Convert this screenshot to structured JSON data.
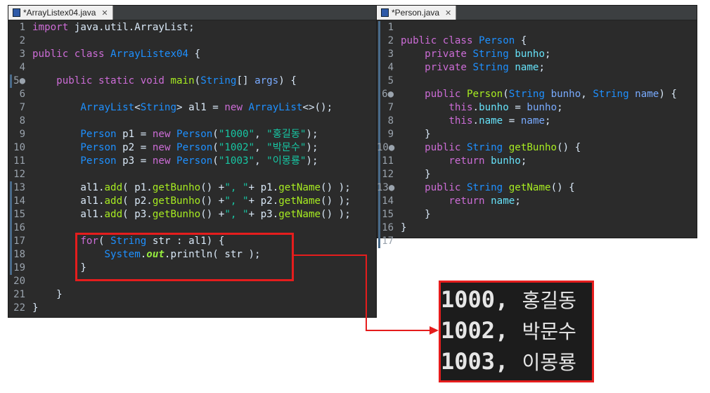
{
  "left_editor": {
    "tab_title": "*ArrayListex04.java",
    "close_glyph": "✕",
    "lines": [
      {
        "n": "1",
        "segs": [
          [
            "kw",
            "import "
          ],
          [
            "plain",
            "java.util.ArrayList;"
          ]
        ]
      },
      {
        "n": "2",
        "segs": []
      },
      {
        "n": "3",
        "segs": [
          [
            "kw",
            "public class "
          ],
          [
            "ty",
            "ArrayListex04 "
          ],
          [
            "plain",
            "{"
          ]
        ]
      },
      {
        "n": "4",
        "segs": []
      },
      {
        "n": "5●",
        "segs": [
          [
            "plain",
            "    "
          ],
          [
            "kw",
            "public static void "
          ],
          [
            "meth",
            "main"
          ],
          [
            "plain",
            "("
          ],
          [
            "ty",
            "String"
          ],
          [
            "plain",
            "[] "
          ],
          [
            "var",
            "args"
          ],
          [
            "plain",
            ") {"
          ]
        ]
      },
      {
        "n": "6",
        "segs": []
      },
      {
        "n": "7",
        "segs": [
          [
            "plain",
            "        "
          ],
          [
            "ty",
            "ArrayList"
          ],
          [
            "plain",
            "<"
          ],
          [
            "ty",
            "String"
          ],
          [
            "plain",
            "> "
          ],
          [
            "plain",
            "al1 = "
          ],
          [
            "kw",
            "new "
          ],
          [
            "ty",
            "ArrayList"
          ],
          [
            "plain",
            "<>();"
          ]
        ]
      },
      {
        "n": "8",
        "segs": []
      },
      {
        "n": "9",
        "segs": [
          [
            "plain",
            "        "
          ],
          [
            "ty",
            "Person "
          ],
          [
            "plain",
            "p1 = "
          ],
          [
            "kw",
            "new "
          ],
          [
            "ty",
            "Person"
          ],
          [
            "plain",
            "("
          ],
          [
            "str",
            "\"1000\""
          ],
          [
            "plain",
            ", "
          ],
          [
            "str",
            "\"홍길동\""
          ],
          [
            "plain",
            ");"
          ]
        ]
      },
      {
        "n": "10",
        "segs": [
          [
            "plain",
            "        "
          ],
          [
            "ty",
            "Person "
          ],
          [
            "plain",
            "p2 = "
          ],
          [
            "kw",
            "new "
          ],
          [
            "ty",
            "Person"
          ],
          [
            "plain",
            "("
          ],
          [
            "str",
            "\"1002\""
          ],
          [
            "plain",
            ", "
          ],
          [
            "str",
            "\"박문수\""
          ],
          [
            "plain",
            ");"
          ]
        ]
      },
      {
        "n": "11",
        "segs": [
          [
            "plain",
            "        "
          ],
          [
            "ty",
            "Person "
          ],
          [
            "plain",
            "p3 = "
          ],
          [
            "kw",
            "new "
          ],
          [
            "ty",
            "Person"
          ],
          [
            "plain",
            "("
          ],
          [
            "str",
            "\"1003\""
          ],
          [
            "plain",
            ", "
          ],
          [
            "str",
            "\"이몽룡\""
          ],
          [
            "plain",
            ");"
          ]
        ]
      },
      {
        "n": "12",
        "segs": []
      },
      {
        "n": "13",
        "segs": [
          [
            "plain",
            "        al1."
          ],
          [
            "meth",
            "add"
          ],
          [
            "plain",
            "( p1."
          ],
          [
            "meth",
            "getBunho"
          ],
          [
            "plain",
            "() +"
          ],
          [
            "str",
            "\", \""
          ],
          [
            "plain",
            "+ p1."
          ],
          [
            "meth",
            "getName"
          ],
          [
            "plain",
            "() );"
          ]
        ]
      },
      {
        "n": "14",
        "segs": [
          [
            "plain",
            "        al1."
          ],
          [
            "meth",
            "add"
          ],
          [
            "plain",
            "( p2."
          ],
          [
            "meth",
            "getBunho"
          ],
          [
            "plain",
            "() +"
          ],
          [
            "str",
            "\", \""
          ],
          [
            "plain",
            "+ p2."
          ],
          [
            "meth",
            "getName"
          ],
          [
            "plain",
            "() );"
          ]
        ]
      },
      {
        "n": "15",
        "segs": [
          [
            "plain",
            "        al1."
          ],
          [
            "meth",
            "add"
          ],
          [
            "plain",
            "( p3."
          ],
          [
            "meth",
            "getBunho"
          ],
          [
            "plain",
            "() +"
          ],
          [
            "str",
            "\", \""
          ],
          [
            "plain",
            "+ p3."
          ],
          [
            "meth",
            "getName"
          ],
          [
            "plain",
            "() );"
          ]
        ]
      },
      {
        "n": "16",
        "segs": []
      },
      {
        "n": "17",
        "segs": [
          [
            "plain",
            "        "
          ],
          [
            "kw",
            "for"
          ],
          [
            "plain",
            "( "
          ],
          [
            "ty",
            "String "
          ],
          [
            "plain",
            "str : al1) {"
          ]
        ]
      },
      {
        "n": "18",
        "segs": [
          [
            "plain",
            "            "
          ],
          [
            "ty",
            "System"
          ],
          [
            "plain",
            "."
          ],
          [
            "it",
            "out"
          ],
          [
            "plain",
            "."
          ],
          [
            "plain",
            "println( str );"
          ]
        ]
      },
      {
        "n": "19",
        "segs": [
          [
            "plain",
            "        }"
          ]
        ]
      },
      {
        "n": "20",
        "segs": []
      },
      {
        "n": "21",
        "segs": [
          [
            "plain",
            "    }"
          ]
        ]
      },
      {
        "n": "22",
        "segs": [
          [
            "plain",
            "}"
          ]
        ]
      }
    ]
  },
  "right_editor": {
    "tab_title": "*Person.java",
    "close_glyph": "✕",
    "lines": [
      {
        "n": "1",
        "segs": []
      },
      {
        "n": "2",
        "segs": [
          [
            "kw",
            "public class "
          ],
          [
            "ty",
            "Person "
          ],
          [
            "plain",
            "{"
          ]
        ]
      },
      {
        "n": "3",
        "segs": [
          [
            "plain",
            "    "
          ],
          [
            "kw",
            "private "
          ],
          [
            "ty",
            "String "
          ],
          [
            "fld",
            "bunho"
          ],
          [
            "plain",
            ";"
          ]
        ]
      },
      {
        "n": "4",
        "segs": [
          [
            "plain",
            "    "
          ],
          [
            "kw",
            "private "
          ],
          [
            "ty",
            "String "
          ],
          [
            "fld",
            "name"
          ],
          [
            "plain",
            ";"
          ]
        ]
      },
      {
        "n": "5",
        "segs": []
      },
      {
        "n": "6●",
        "segs": [
          [
            "plain",
            "    "
          ],
          [
            "kw",
            "public "
          ],
          [
            "meth",
            "Person"
          ],
          [
            "plain",
            "("
          ],
          [
            "ty",
            "String "
          ],
          [
            "var",
            "bunho"
          ],
          [
            "plain",
            ", "
          ],
          [
            "ty",
            "String "
          ],
          [
            "var",
            "name"
          ],
          [
            "plain",
            ") {"
          ]
        ]
      },
      {
        "n": "7",
        "segs": [
          [
            "plain",
            "        "
          ],
          [
            "kw",
            "this"
          ],
          [
            "plain",
            "."
          ],
          [
            "fld",
            "bunho"
          ],
          [
            "plain",
            " = "
          ],
          [
            "var",
            "bunho"
          ],
          [
            "plain",
            ";"
          ]
        ]
      },
      {
        "n": "8",
        "segs": [
          [
            "plain",
            "        "
          ],
          [
            "kw",
            "this"
          ],
          [
            "plain",
            "."
          ],
          [
            "fld",
            "name"
          ],
          [
            "plain",
            " = "
          ],
          [
            "var",
            "name"
          ],
          [
            "plain",
            ";"
          ]
        ]
      },
      {
        "n": "9",
        "segs": [
          [
            "plain",
            "    }"
          ]
        ]
      },
      {
        "n": "10●",
        "segs": [
          [
            "plain",
            "    "
          ],
          [
            "kw",
            "public "
          ],
          [
            "ty",
            "String "
          ],
          [
            "meth",
            "getBunho"
          ],
          [
            "plain",
            "() {"
          ]
        ]
      },
      {
        "n": "11",
        "segs": [
          [
            "plain",
            "        "
          ],
          [
            "kw",
            "return "
          ],
          [
            "fld",
            "bunho"
          ],
          [
            "plain",
            ";"
          ]
        ]
      },
      {
        "n": "12",
        "segs": [
          [
            "plain",
            "    }"
          ]
        ]
      },
      {
        "n": "13●",
        "segs": [
          [
            "plain",
            "    "
          ],
          [
            "kw",
            "public "
          ],
          [
            "ty",
            "String "
          ],
          [
            "meth",
            "getName"
          ],
          [
            "plain",
            "() {"
          ]
        ]
      },
      {
        "n": "14",
        "segs": [
          [
            "plain",
            "        "
          ],
          [
            "kw",
            "return "
          ],
          [
            "fld",
            "name"
          ],
          [
            "plain",
            ";"
          ]
        ]
      },
      {
        "n": "15",
        "segs": [
          [
            "plain",
            "    }"
          ]
        ]
      },
      {
        "n": "16",
        "segs": [
          [
            "plain",
            "}"
          ]
        ]
      },
      {
        "n": "17",
        "segs": []
      }
    ]
  },
  "console_output": {
    "lines": [
      {
        "num": "1000,",
        "name": "홍길동"
      },
      {
        "num": "1002,",
        "name": "박문수"
      },
      {
        "num": "1003,",
        "name": "이몽룡"
      }
    ]
  },
  "colors": {
    "editor_bg": "#2b2b2b",
    "highlight": "#e51d1d"
  }
}
